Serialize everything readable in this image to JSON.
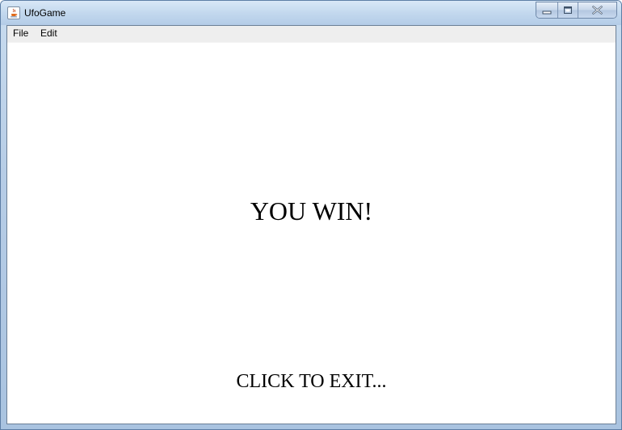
{
  "window": {
    "title": "UfoGame"
  },
  "menubar": {
    "items": [
      {
        "label": "File"
      },
      {
        "label": "Edit"
      }
    ]
  },
  "game": {
    "win_message": "YOU WIN!",
    "exit_message": "CLICK TO EXIT..."
  },
  "icons": {
    "app": "java-cup-icon",
    "minimize": "minimize-icon",
    "restore": "restore-icon",
    "close": "close-icon"
  },
  "colors": {
    "titlebar": "#c3d8ee",
    "canvas_background": "#ffffff",
    "menubar_background": "#eeeeee",
    "text": "#000000"
  }
}
